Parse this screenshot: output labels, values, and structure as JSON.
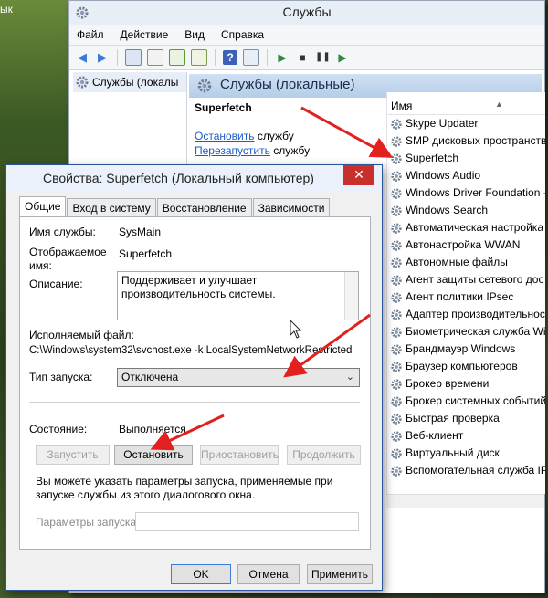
{
  "desktop": {
    "corner_text": "ык"
  },
  "window": {
    "title": "Службы",
    "menu": [
      "Файл",
      "Действие",
      "Вид",
      "Справка"
    ]
  },
  "tree": {
    "item": "Службы (локалы"
  },
  "pane": {
    "header": "Службы (локальные)",
    "service_name": "Superfetch",
    "stop_link": "Остановить",
    "stop_suffix": " службу",
    "restart_link": "Перезапустить",
    "restart_suffix": " службу"
  },
  "list": {
    "column_name": "Имя",
    "services": [
      "Skype Updater",
      "SMP дисковых пространств",
      "Superfetch",
      "Windows Audio",
      "Windows Driver Foundation -",
      "Windows Search",
      "Автоматическая настройка",
      "Автонастройка WWAN",
      "Автономные файлы",
      "Агент защиты сетевого дос",
      "Агент политики IPsec",
      "Адаптер производительност",
      "Биометрическая служба Wi",
      "Брандмауэр Windows",
      "Браузер компьютеров",
      "Брокер времени",
      "Брокер системных событий",
      "Быстрая проверка",
      "Веб-клиент",
      "Виртуальный диск",
      "Вспомогательная служба IP"
    ]
  },
  "dialog": {
    "title": "Свойства: Superfetch (Локальный компьютер)",
    "tabs": [
      "Общие",
      "Вход в систему",
      "Восстановление",
      "Зависимости"
    ],
    "service_name_label": "Имя службы:",
    "service_name_value": "SysMain",
    "display_name_label": "Отображаемое имя:",
    "display_name_value": "Superfetch",
    "description_label": "Описание:",
    "description_value": "Поддерживает и улучшает производительность системы.",
    "exe_label": "Исполняемый файл:",
    "exe_value": "C:\\Windows\\system32\\svchost.exe -k LocalSystemNetworkRestricted",
    "startup_label": "Тип запуска:",
    "startup_value": "Отключена",
    "state_label": "Состояние:",
    "state_value": "Выполняется",
    "btn_start": "Запустить",
    "btn_stop": "Остановить",
    "btn_pause": "Приостановить",
    "btn_continue": "Продолжить",
    "hint": "Вы можете указать параметры запуска, применяемые при запуске службы из этого диалогового окна.",
    "params_label": "Параметры запуска:",
    "params_value": "",
    "btn_ok": "OK",
    "btn_cancel": "Отмена",
    "btn_apply": "Применить",
    "close_glyph": "✕"
  },
  "colors": {
    "accent": "#2b579a",
    "arrow": "#e32020",
    "link": "#1a5ccc"
  }
}
